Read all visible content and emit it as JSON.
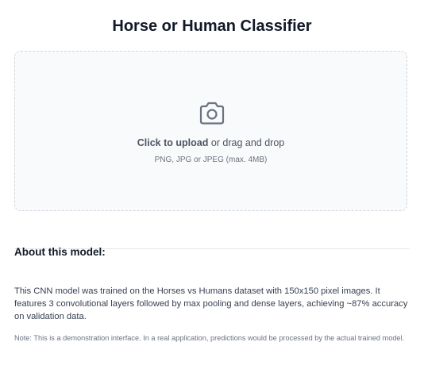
{
  "header": {
    "title": "Horse or Human Classifier"
  },
  "upload": {
    "icon": "camera-icon",
    "click_label": "Click to upload",
    "drag_label": " or drag and drop",
    "hint": "PNG, JPG or JPEG (max. 4MB)"
  },
  "about": {
    "heading": "About this model:",
    "description": "This CNN model was trained on the Horses vs Humans dataset with 150x150 pixel images. It features 3 convolutional layers followed by max pooling and dense layers, achieving ~87% accuracy on validation data.",
    "note": "Note: This is a demonstration interface. In a real application, predictions would be processed by the actual trained model."
  },
  "colors": {
    "accent": "#6b7280",
    "border": "#d1d5db",
    "background": "#f9fafb"
  }
}
